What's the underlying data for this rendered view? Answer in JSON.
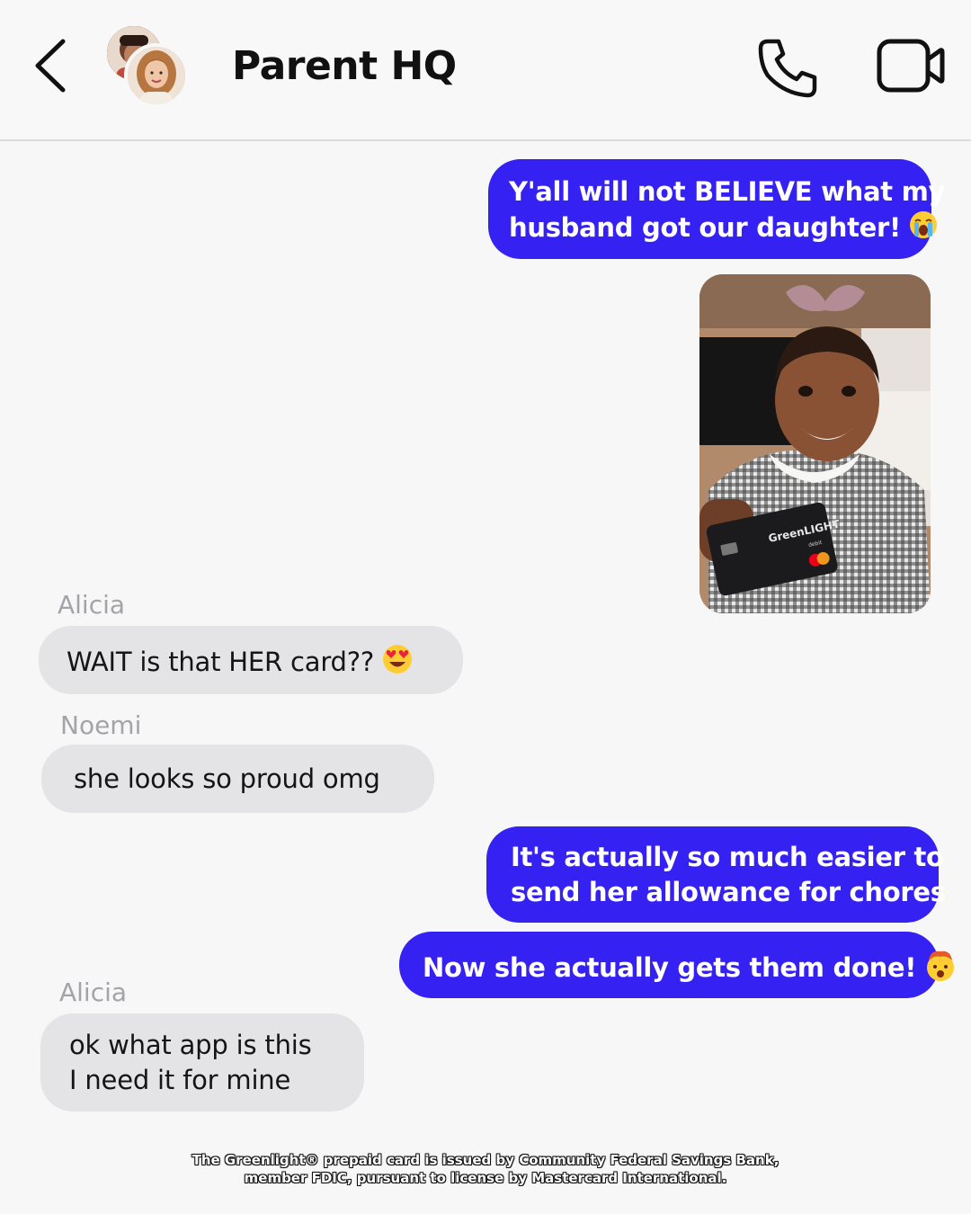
{
  "header": {
    "title": "Parent HQ",
    "back_icon": "chevron-left-icon",
    "call_icon": "phone-icon",
    "video_icon": "video-camera-icon"
  },
  "messages": [
    {
      "type": "sent",
      "lines": [
        "Y'all will not BELIEVE what my",
        "husband got our daughter!"
      ],
      "emoji": "loudly-crying-face"
    },
    {
      "type": "sent-image",
      "card_brand": "GreenLIGHT",
      "card_label": "debit"
    },
    {
      "type": "received",
      "sender": "Alicia",
      "lines": [
        "WAIT is that HER card??"
      ],
      "emoji": "heart-eyes-face"
    },
    {
      "type": "received",
      "sender": "Noemi",
      "lines": [
        "she looks so proud omg"
      ]
    },
    {
      "type": "sent",
      "lines": [
        "It's actually so much easier to",
        "send her allowance for chores"
      ]
    },
    {
      "type": "sent",
      "lines": [
        "Now she actually gets them done!"
      ],
      "emoji": "exploding-head"
    },
    {
      "type": "received",
      "sender": "Alicia",
      "lines": [
        "ok what app is this",
        "I need it for mine"
      ]
    }
  ],
  "disclaimer": {
    "line1": "The Greenlight® prepaid card is issued by Community Federal Savings Bank,",
    "line2": "member FDIC, pursuant to license by Mastercard International."
  },
  "colors": {
    "sent_bubble": "#3522f2",
    "received_bubble": "#e4e4e7",
    "background": "#f7f7f8",
    "sender_name": "#a4a4a8"
  }
}
